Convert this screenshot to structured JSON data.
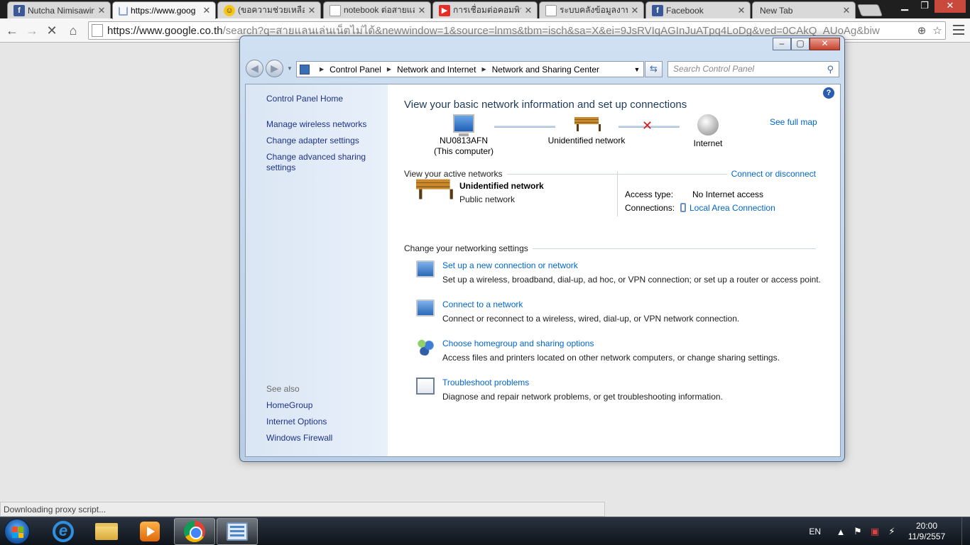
{
  "browser": {
    "tabs": [
      {
        "title": "Nutcha Nimisawin",
        "icon": "facebook-icon"
      },
      {
        "title": "https://www.goog",
        "icon": "loading-icon"
      },
      {
        "title": "(ขอความช่วยเหลือด่วน",
        "icon": "smiley-icon"
      },
      {
        "title": "notebook ต่อสายแลน",
        "icon": "document-icon"
      },
      {
        "title": "การเชื่อมต่อคอมพิวเตอร์",
        "icon": "youtube-icon"
      },
      {
        "title": "ระบบคลังข้อมูลงานวิจัย",
        "icon": "document-icon"
      },
      {
        "title": "Facebook",
        "icon": "facebook-icon"
      },
      {
        "title": "New Tab",
        "icon": "none"
      }
    ],
    "url_main": "https://www.google.co.th",
    "url_rest": "/search?q=สายแลนเล่นเน็ตไม่ได้&newwindow=1&source=lnms&tbm=isch&sa=X&ei=9JsRVIqAGInJuATpq4LoDg&ved=0CAkQ_AUoAg&biw",
    "status": "Downloading proxy script..."
  },
  "control_panel": {
    "breadcrumb": [
      "Control Panel",
      "Network and Internet",
      "Network and Sharing Center"
    ],
    "search_placeholder": "Search Control Panel",
    "left": {
      "home": "Control Panel Home",
      "links": [
        "Manage wireless networks",
        "Change adapter settings",
        "Change advanced sharing settings"
      ],
      "see_also_label": "See also",
      "see_also": [
        "HomeGroup",
        "Internet Options",
        "Windows Firewall"
      ]
    },
    "main": {
      "title": "View your basic network information and set up connections",
      "see_full_map": "See full map",
      "map": {
        "computer": "NU0813AFN",
        "computer_sub": "(This computer)",
        "network": "Unidentified network",
        "internet": "Internet"
      },
      "active_header": "View your active networks",
      "connect_disconnect": "Connect or disconnect",
      "active": {
        "name": "Unidentified network",
        "type": "Public network",
        "access_label": "Access type:",
        "access_value": "No Internet access",
        "connections_label": "Connections:",
        "connections_value": "Local Area Connection"
      },
      "change_header": "Change your networking settings",
      "tasks": [
        {
          "title": "Set up a new connection or network",
          "desc": "Set up a wireless, broadband, dial-up, ad hoc, or VPN connection; or set up a router or access point.",
          "icon": "new-connection-icon"
        },
        {
          "title": "Connect to a network",
          "desc": "Connect or reconnect to a wireless, wired, dial-up, or VPN network connection.",
          "icon": "connect-network-icon"
        },
        {
          "title": "Choose homegroup and sharing options",
          "desc": "Access files and printers located on other network computers, or change sharing settings.",
          "icon": "homegroup-icon"
        },
        {
          "title": "Troubleshoot problems",
          "desc": "Diagnose and repair network problems, or get troubleshooting information.",
          "icon": "troubleshoot-icon"
        }
      ]
    }
  },
  "taskbar": {
    "lang": "EN",
    "time": "20:00",
    "date": "11/9/2557"
  }
}
